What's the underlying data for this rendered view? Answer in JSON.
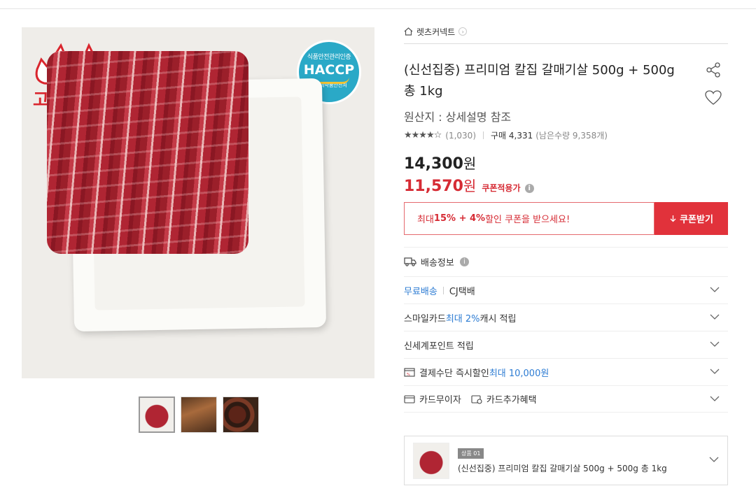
{
  "gallery": {
    "brand_logo_text": "고기중독",
    "haccp_top": "식품안전관리인증",
    "haccp_main": "HACCP",
    "haccp_bottom": "식품의약품안전처"
  },
  "breadcrumb": {
    "store": "렛츠커넥트"
  },
  "product": {
    "title": "(신선집중) 프리미엄 칼집 갈매기살 500g + 500g 총 1kg",
    "origin": "원산지 : 상세설명 참조",
    "stars": "★★★★☆",
    "rating_value": 4.5,
    "review_count": "(1,030)",
    "purchase": "구매 4,331",
    "stock": "(남은수량 9,358개)",
    "price_original": "14,300",
    "price_sale": "11,570",
    "currency": "원",
    "coupon_tag": "쿠폰적용가"
  },
  "coupon": {
    "text_prefix": "최대 ",
    "text_bold": "15% + 4%",
    "text_suffix": " 할인 쿠폰을 받으세요!",
    "button_label": "쿠폰받기"
  },
  "shipping": {
    "header": "배송정보"
  },
  "rows": {
    "delivery_free": "무료배송",
    "delivery_courier": "CJ택배",
    "smile_prefix": "스마일카드 ",
    "smile_highlight": "최대 2%",
    "smile_suffix": " 캐시 적립",
    "shinsegae": "신세계포인트 적립",
    "payment_prefix": "결제수단 즉시할인 ",
    "payment_highlight": "최대 10,000원",
    "card_interest": "카드무이자",
    "card_benefit": "카드추가혜택"
  },
  "option": {
    "badge": "상품 01",
    "name": "(신선집중) 프리미엄 칼집 갈매기살 500g + 500g 총 1kg"
  },
  "colors": {
    "accent_red": "#d62b34",
    "button_red": "#e1323b",
    "link_blue": "#2d7cd3"
  }
}
